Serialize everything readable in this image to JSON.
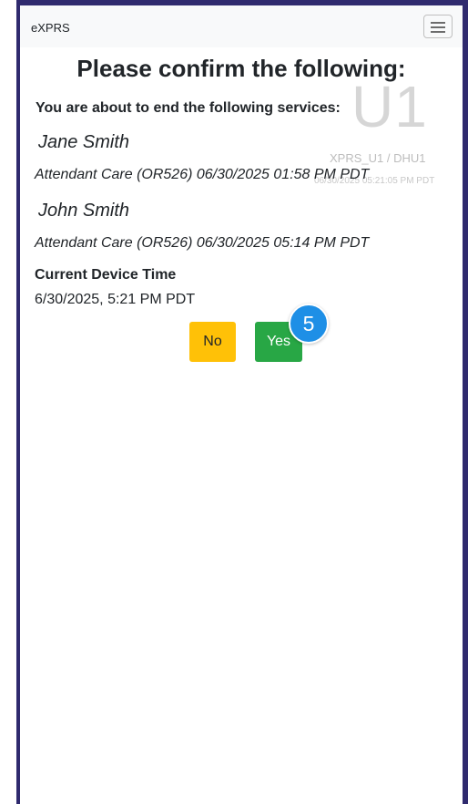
{
  "navbar": {
    "brand": "eXPRS",
    "toggle_icon": "hamburger-menu-icon"
  },
  "watermark": {
    "initials": "U1",
    "user_line": "XPRS_U1 / DHU1",
    "timestamp": "06/30/2025 05:21:05 PM PDT"
  },
  "confirm": {
    "title": "Please confirm the following:",
    "subtitle": "You are about to end the following services:",
    "services": [
      {
        "name": "Jane Smith",
        "detail": "Attendant Care (OR526) 06/30/2025 01:58 PM PDT"
      },
      {
        "name": "John Smith",
        "detail": "Attendant Care (OR526) 06/30/2025 05:14 PM PDT"
      }
    ],
    "device_time_label": "Current Device Time",
    "device_time_value": "6/30/2025, 5:21 PM PDT"
  },
  "buttons": {
    "no_label": "No",
    "yes_label": "Yes",
    "no_color": "#ffc107",
    "yes_color": "#28a745"
  },
  "step_badge": {
    "number": "5",
    "color": "#1e8fe6"
  }
}
